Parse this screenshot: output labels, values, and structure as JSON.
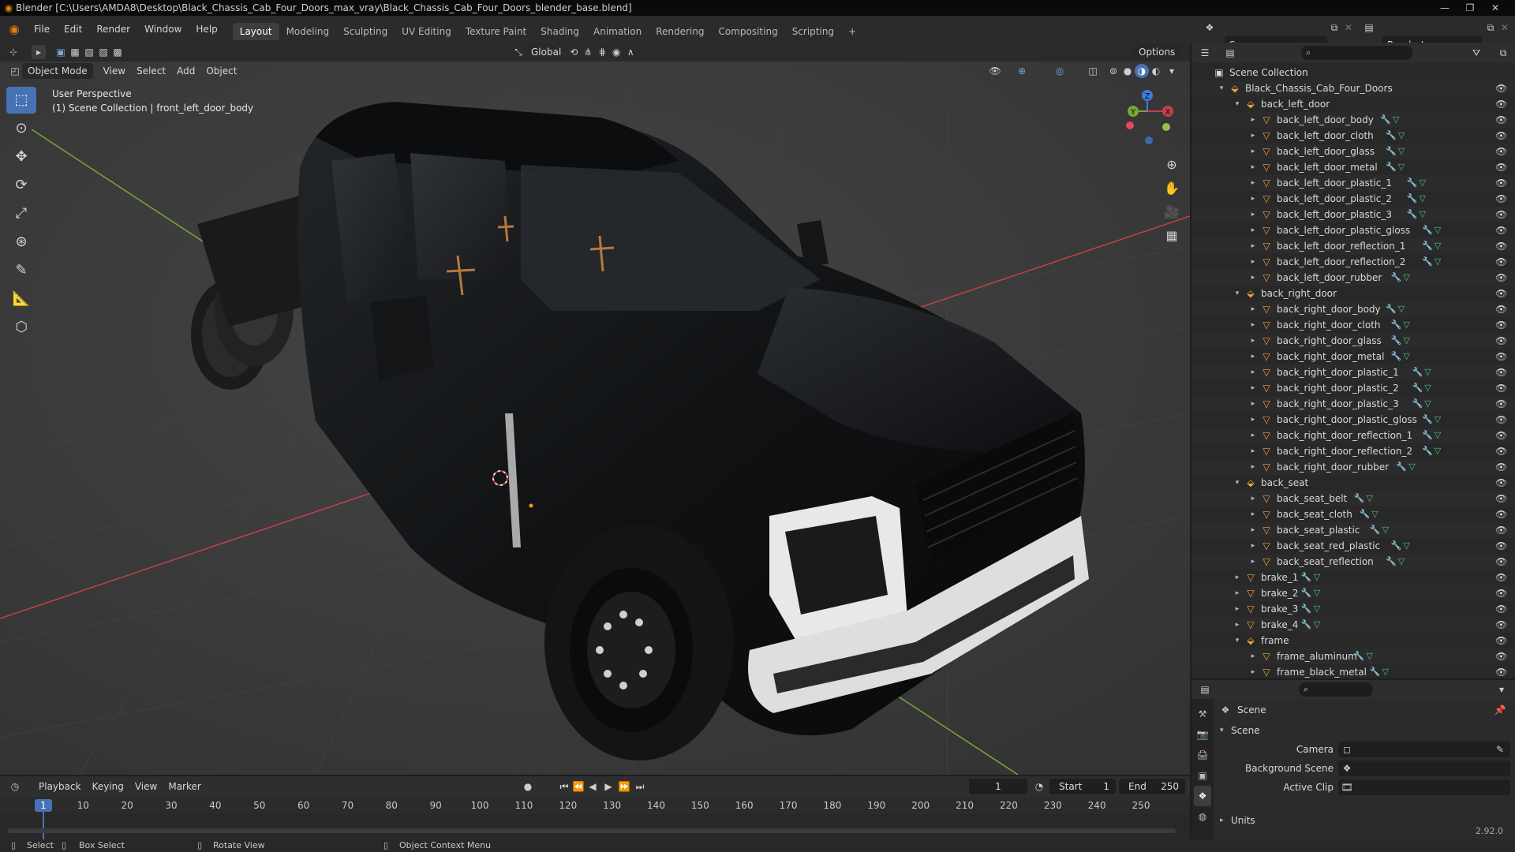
{
  "window": {
    "title": "Blender [C:\\Users\\AMDA8\\Desktop\\Black_Chassis_Cab_Four_Doors_max_vray\\Black_Chassis_Cab_Four_Doors_blender_base.blend]",
    "minimize": "—",
    "maximize": "❐",
    "close": "✕"
  },
  "menu": {
    "items": [
      "File",
      "Edit",
      "Render",
      "Window",
      "Help"
    ],
    "workspaces": [
      "Layout",
      "Modeling",
      "Sculpting",
      "UV Editing",
      "Texture Paint",
      "Shading",
      "Animation",
      "Rendering",
      "Compositing",
      "Scripting"
    ],
    "add_workspace": "+",
    "scene": "Scene",
    "render_layer": "RenderLayer"
  },
  "viewport": {
    "mode": "Object Mode",
    "menus": [
      "View",
      "Select",
      "Add",
      "Object"
    ],
    "transform": "Global",
    "options": "Options",
    "perspective": "User Perspective",
    "context": "(1) Scene Collection | front_left_door_body",
    "gizmo": {
      "x": "X",
      "y": "Y",
      "z": "Z"
    },
    "colors": {
      "x_axis": "#c2404e",
      "y_axis": "#7aa53a",
      "background": "#3c3c3c",
      "accent": "#4772b3"
    }
  },
  "outliner": {
    "search_placeholder": "",
    "rows": [
      {
        "label": "Scene Collection",
        "depth": 0,
        "kind": "scene",
        "arrow": ""
      },
      {
        "label": "Black_Chassis_Cab_Four_Doors",
        "depth": 1,
        "kind": "coll",
        "arrow": "▾"
      },
      {
        "label": "back_left_door",
        "depth": 2,
        "kind": "coll",
        "arrow": "▾"
      },
      {
        "label": "back_left_door_body",
        "depth": 3,
        "kind": "obj",
        "arrow": "▸"
      },
      {
        "label": "back_left_door_cloth",
        "depth": 3,
        "kind": "obj",
        "arrow": "▸"
      },
      {
        "label": "back_left_door_glass",
        "depth": 3,
        "kind": "obj",
        "arrow": "▸"
      },
      {
        "label": "back_left_door_metal",
        "depth": 3,
        "kind": "obj",
        "arrow": "▸"
      },
      {
        "label": "back_left_door_plastic_1",
        "depth": 3,
        "kind": "obj",
        "arrow": "▸"
      },
      {
        "label": "back_left_door_plastic_2",
        "depth": 3,
        "kind": "obj",
        "arrow": "▸"
      },
      {
        "label": "back_left_door_plastic_3",
        "depth": 3,
        "kind": "obj",
        "arrow": "▸"
      },
      {
        "label": "back_left_door_plastic_gloss",
        "depth": 3,
        "kind": "obj",
        "arrow": "▸"
      },
      {
        "label": "back_left_door_reflection_1",
        "depth": 3,
        "kind": "obj",
        "arrow": "▸"
      },
      {
        "label": "back_left_door_reflection_2",
        "depth": 3,
        "kind": "obj",
        "arrow": "▸"
      },
      {
        "label": "back_left_door_rubber",
        "depth": 3,
        "kind": "obj",
        "arrow": "▸"
      },
      {
        "label": "back_right_door",
        "depth": 2,
        "kind": "coll",
        "arrow": "▾"
      },
      {
        "label": "back_right_door_body",
        "depth": 3,
        "kind": "obj",
        "arrow": "▸"
      },
      {
        "label": "back_right_door_cloth",
        "depth": 3,
        "kind": "obj",
        "arrow": "▸"
      },
      {
        "label": "back_right_door_glass",
        "depth": 3,
        "kind": "obj",
        "arrow": "▸"
      },
      {
        "label": "back_right_door_metal",
        "depth": 3,
        "kind": "obj",
        "arrow": "▸"
      },
      {
        "label": "back_right_door_plastic_1",
        "depth": 3,
        "kind": "obj",
        "arrow": "▸"
      },
      {
        "label": "back_right_door_plastic_2",
        "depth": 3,
        "kind": "obj",
        "arrow": "▸"
      },
      {
        "label": "back_right_door_plastic_3",
        "depth": 3,
        "kind": "obj",
        "arrow": "▸"
      },
      {
        "label": "back_right_door_plastic_gloss",
        "depth": 3,
        "kind": "obj",
        "arrow": "▸"
      },
      {
        "label": "back_right_door_reflection_1",
        "depth": 3,
        "kind": "obj",
        "arrow": "▸"
      },
      {
        "label": "back_right_door_reflection_2",
        "depth": 3,
        "kind": "obj",
        "arrow": "▸"
      },
      {
        "label": "back_right_door_rubber",
        "depth": 3,
        "kind": "obj",
        "arrow": "▸"
      },
      {
        "label": "back_seat",
        "depth": 2,
        "kind": "coll",
        "arrow": "▾"
      },
      {
        "label": "back_seat_belt",
        "depth": 3,
        "kind": "obj",
        "arrow": "▸"
      },
      {
        "label": "back_seat_cloth",
        "depth": 3,
        "kind": "obj",
        "arrow": "▸"
      },
      {
        "label": "back_seat_plastic",
        "depth": 3,
        "kind": "obj",
        "arrow": "▸"
      },
      {
        "label": "back_seat_red_plastic",
        "depth": 3,
        "kind": "obj",
        "arrow": "▸"
      },
      {
        "label": "back_seat_reflection",
        "depth": 3,
        "kind": "obj",
        "arrow": "▸"
      },
      {
        "label": "brake_1",
        "depth": 2,
        "kind": "obj",
        "arrow": "▸"
      },
      {
        "label": "brake_2",
        "depth": 2,
        "kind": "obj",
        "arrow": "▸"
      },
      {
        "label": "brake_3",
        "depth": 2,
        "kind": "obj",
        "arrow": "▸"
      },
      {
        "label": "brake_4",
        "depth": 2,
        "kind": "obj",
        "arrow": "▸"
      },
      {
        "label": "frame",
        "depth": 2,
        "kind": "coll",
        "arrow": "▾"
      },
      {
        "label": "frame_aluminum",
        "depth": 3,
        "kind": "obj",
        "arrow": "▸"
      },
      {
        "label": "frame_black_metal",
        "depth": 3,
        "kind": "obj",
        "arrow": "▸"
      }
    ]
  },
  "properties": {
    "breadcrumb": "Scene",
    "section": "Scene",
    "camera_label": "Camera",
    "background_scene_label": "Background Scene",
    "active_clip_label": "Active Clip",
    "units_label": "Units",
    "version": "2.92.0"
  },
  "timeline": {
    "menus": [
      "Playback",
      "Keying",
      "View",
      "Marker"
    ],
    "current_frame": "1",
    "start_label": "Start",
    "start": "1",
    "end_label": "End",
    "end": "250",
    "ticks": [
      "10",
      "20",
      "30",
      "40",
      "50",
      "60",
      "70",
      "80",
      "90",
      "100",
      "110",
      "120",
      "130",
      "140",
      "150",
      "160",
      "170",
      "180",
      "190",
      "200",
      "210",
      "220",
      "230",
      "240",
      "250"
    ]
  },
  "status": {
    "select": "Select",
    "box_select": "Box Select",
    "rotate_view": "Rotate View",
    "context_menu": "Object Context Menu"
  }
}
